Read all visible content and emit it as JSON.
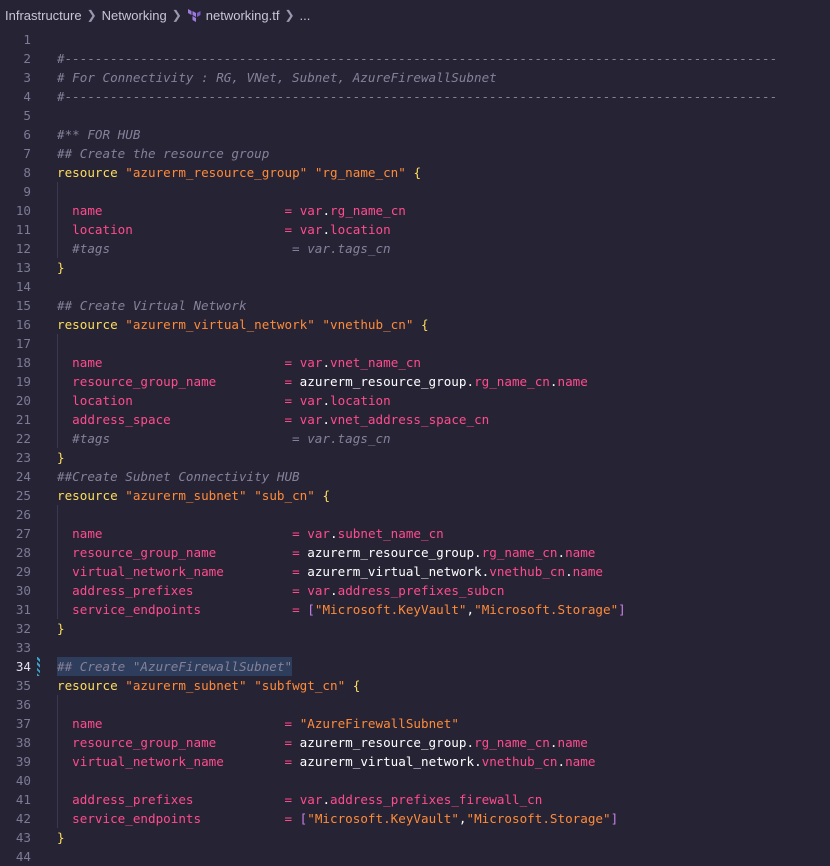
{
  "breadcrumb": {
    "items": [
      "Infrastructure",
      "Networking",
      "networking.tf",
      "..."
    ],
    "icon": "terraform-icon"
  },
  "editor": {
    "active_line": 34,
    "lines": [
      {
        "n": "1",
        "t": []
      },
      {
        "n": "2",
        "t": [
          [
            "c",
            "#----------------------------------------------------------------------------------------------"
          ]
        ]
      },
      {
        "n": "3",
        "t": [
          [
            "c",
            "# For Connectivity : RG, VNet, Subnet, AzureFirewallSubnet"
          ]
        ]
      },
      {
        "n": "4",
        "t": [
          [
            "c",
            "#----------------------------------------------------------------------------------------------"
          ]
        ]
      },
      {
        "n": "5",
        "t": []
      },
      {
        "n": "6",
        "t": [
          [
            "c",
            "#** FOR HUB"
          ]
        ]
      },
      {
        "n": "7",
        "t": [
          [
            "c",
            "## Create the resource group"
          ]
        ]
      },
      {
        "n": "8",
        "t": [
          [
            "kw",
            "resource"
          ],
          [
            "w",
            " "
          ],
          [
            "str",
            "\"azurerm_resource_group\""
          ],
          [
            "w",
            " "
          ],
          [
            "str",
            "\"rg_name_cn\""
          ],
          [
            "w",
            " "
          ],
          [
            "p",
            "{"
          ]
        ]
      },
      {
        "n": "9",
        "t": []
      },
      {
        "n": "10",
        "t": [
          [
            "w",
            "  "
          ],
          [
            "attr",
            "name"
          ],
          [
            "w",
            "                        "
          ],
          [
            "attr",
            "="
          ],
          [
            "w",
            " "
          ],
          [
            "attr",
            "var"
          ],
          [
            "w",
            "."
          ],
          [
            "attr",
            "rg_name_cn"
          ]
        ]
      },
      {
        "n": "11",
        "t": [
          [
            "w",
            "  "
          ],
          [
            "attr",
            "location"
          ],
          [
            "w",
            "                    "
          ],
          [
            "attr",
            "="
          ],
          [
            "w",
            " "
          ],
          [
            "attr",
            "var"
          ],
          [
            "w",
            "."
          ],
          [
            "attr",
            "location"
          ]
        ]
      },
      {
        "n": "12",
        "t": [
          [
            "w",
            "  "
          ],
          [
            "c",
            "#tags                        = var.tags_cn"
          ]
        ]
      },
      {
        "n": "13",
        "t": [
          [
            "p",
            "}"
          ]
        ]
      },
      {
        "n": "14",
        "t": []
      },
      {
        "n": "15",
        "t": [
          [
            "c",
            "## Create Virtual Network"
          ]
        ]
      },
      {
        "n": "16",
        "t": [
          [
            "kw",
            "resource"
          ],
          [
            "w",
            " "
          ],
          [
            "str",
            "\"azurerm_virtual_network\""
          ],
          [
            "w",
            " "
          ],
          [
            "str",
            "\"vnethub_cn\""
          ],
          [
            "w",
            " "
          ],
          [
            "p",
            "{"
          ]
        ]
      },
      {
        "n": "17",
        "t": []
      },
      {
        "n": "18",
        "t": [
          [
            "w",
            "  "
          ],
          [
            "attr",
            "name"
          ],
          [
            "w",
            "                        "
          ],
          [
            "attr",
            "="
          ],
          [
            "w",
            " "
          ],
          [
            "attr",
            "var"
          ],
          [
            "w",
            "."
          ],
          [
            "attr",
            "vnet_name_cn"
          ]
        ]
      },
      {
        "n": "19",
        "t": [
          [
            "w",
            "  "
          ],
          [
            "attr",
            "resource_group_name"
          ],
          [
            "w",
            "         "
          ],
          [
            "attr",
            "="
          ],
          [
            "w",
            " azurerm_resource_group."
          ],
          [
            "attr",
            "rg_name_cn"
          ],
          [
            "w",
            "."
          ],
          [
            "attr",
            "name"
          ]
        ]
      },
      {
        "n": "20",
        "t": [
          [
            "w",
            "  "
          ],
          [
            "attr",
            "location"
          ],
          [
            "w",
            "                    "
          ],
          [
            "attr",
            "="
          ],
          [
            "w",
            " "
          ],
          [
            "attr",
            "var"
          ],
          [
            "w",
            "."
          ],
          [
            "attr",
            "location"
          ]
        ]
      },
      {
        "n": "21",
        "t": [
          [
            "w",
            "  "
          ],
          [
            "attr",
            "address_space"
          ],
          [
            "w",
            "               "
          ],
          [
            "attr",
            "="
          ],
          [
            "w",
            " "
          ],
          [
            "attr",
            "var"
          ],
          [
            "w",
            "."
          ],
          [
            "attr",
            "vnet_address_space_cn"
          ]
        ]
      },
      {
        "n": "22",
        "t": [
          [
            "w",
            "  "
          ],
          [
            "c",
            "#tags                        = var.tags_cn"
          ]
        ]
      },
      {
        "n": "23",
        "t": [
          [
            "p",
            "}"
          ]
        ]
      },
      {
        "n": "24",
        "t": [
          [
            "c",
            "##Create Subnet Connectivity HUB"
          ]
        ]
      },
      {
        "n": "25",
        "t": [
          [
            "kw",
            "resource"
          ],
          [
            "w",
            " "
          ],
          [
            "str",
            "\"azurerm_subnet\""
          ],
          [
            "w",
            " "
          ],
          [
            "str",
            "\"sub_cn\""
          ],
          [
            "w",
            " "
          ],
          [
            "p",
            "{"
          ]
        ]
      },
      {
        "n": "26",
        "t": []
      },
      {
        "n": "27",
        "t": [
          [
            "w",
            "  "
          ],
          [
            "attr",
            "name"
          ],
          [
            "w",
            "                         "
          ],
          [
            "attr",
            "="
          ],
          [
            "w",
            " "
          ],
          [
            "attr",
            "var"
          ],
          [
            "w",
            "."
          ],
          [
            "attr",
            "subnet_name_cn"
          ]
        ]
      },
      {
        "n": "28",
        "t": [
          [
            "w",
            "  "
          ],
          [
            "attr",
            "resource_group_name"
          ],
          [
            "w",
            "          "
          ],
          [
            "attr",
            "="
          ],
          [
            "w",
            " azurerm_resource_group."
          ],
          [
            "attr",
            "rg_name_cn"
          ],
          [
            "w",
            "."
          ],
          [
            "attr",
            "name"
          ]
        ]
      },
      {
        "n": "29",
        "t": [
          [
            "w",
            "  "
          ],
          [
            "attr",
            "virtual_network_name"
          ],
          [
            "w",
            "         "
          ],
          [
            "attr",
            "="
          ],
          [
            "w",
            " azurerm_virtual_network."
          ],
          [
            "attr",
            "vnethub_cn"
          ],
          [
            "w",
            "."
          ],
          [
            "attr",
            "name"
          ]
        ]
      },
      {
        "n": "30",
        "t": [
          [
            "w",
            "  "
          ],
          [
            "attr",
            "address_prefixes"
          ],
          [
            "w",
            "             "
          ],
          [
            "attr",
            "="
          ],
          [
            "w",
            " "
          ],
          [
            "attr",
            "var"
          ],
          [
            "w",
            "."
          ],
          [
            "attr",
            "address_prefixes_subcn"
          ]
        ]
      },
      {
        "n": "31",
        "t": [
          [
            "w",
            "  "
          ],
          [
            "attr",
            "service_endpoints"
          ],
          [
            "w",
            "            "
          ],
          [
            "attr",
            "="
          ],
          [
            "w",
            " "
          ],
          [
            "br",
            "["
          ],
          [
            "str",
            "\"Microsoft.KeyVault\""
          ],
          [
            "w",
            ","
          ],
          [
            "str",
            "\"Microsoft.Storage\""
          ],
          [
            "br",
            "]"
          ]
        ]
      },
      {
        "n": "32",
        "t": [
          [
            "p",
            "}"
          ]
        ]
      },
      {
        "n": "33",
        "t": []
      },
      {
        "n": "34",
        "t": [
          [
            "c",
            "## Create \"AzureFirewallSubnet\""
          ]
        ],
        "highlight": true
      },
      {
        "n": "35",
        "t": [
          [
            "kw",
            "resource"
          ],
          [
            "w",
            " "
          ],
          [
            "str",
            "\"azurerm_subnet\""
          ],
          [
            "w",
            " "
          ],
          [
            "str",
            "\"subfwgt_cn\""
          ],
          [
            "w",
            " "
          ],
          [
            "p",
            "{"
          ]
        ]
      },
      {
        "n": "36",
        "t": []
      },
      {
        "n": "37",
        "t": [
          [
            "w",
            "  "
          ],
          [
            "attr",
            "name"
          ],
          [
            "w",
            "                        "
          ],
          [
            "attr",
            "="
          ],
          [
            "w",
            " "
          ],
          [
            "str",
            "\"AzureFirewallSubnet\""
          ]
        ]
      },
      {
        "n": "38",
        "t": [
          [
            "w",
            "  "
          ],
          [
            "attr",
            "resource_group_name"
          ],
          [
            "w",
            "         "
          ],
          [
            "attr",
            "="
          ],
          [
            "w",
            " azurerm_resource_group."
          ],
          [
            "attr",
            "rg_name_cn"
          ],
          [
            "w",
            "."
          ],
          [
            "attr",
            "name"
          ]
        ]
      },
      {
        "n": "39",
        "t": [
          [
            "w",
            "  "
          ],
          [
            "attr",
            "virtual_network_name"
          ],
          [
            "w",
            "        "
          ],
          [
            "attr",
            "="
          ],
          [
            "w",
            " azurerm_virtual_network."
          ],
          [
            "attr",
            "vnethub_cn"
          ],
          [
            "w",
            "."
          ],
          [
            "attr",
            "name"
          ]
        ]
      },
      {
        "n": "40",
        "t": []
      },
      {
        "n": "41",
        "t": [
          [
            "w",
            "  "
          ],
          [
            "attr",
            "address_prefixes"
          ],
          [
            "w",
            "            "
          ],
          [
            "attr",
            "="
          ],
          [
            "w",
            " "
          ],
          [
            "attr",
            "var"
          ],
          [
            "w",
            "."
          ],
          [
            "attr",
            "address_prefixes_firewall_cn"
          ]
        ]
      },
      {
        "n": "42",
        "t": [
          [
            "w",
            "  "
          ],
          [
            "attr",
            "service_endpoints"
          ],
          [
            "w",
            "           "
          ],
          [
            "attr",
            "="
          ],
          [
            "w",
            " "
          ],
          [
            "br",
            "["
          ],
          [
            "str",
            "\"Microsoft.KeyVault\""
          ],
          [
            "w",
            ","
          ],
          [
            "str",
            "\"Microsoft.Storage\""
          ],
          [
            "br",
            "]"
          ]
        ]
      },
      {
        "n": "43",
        "t": [
          [
            "p",
            "}"
          ]
        ]
      },
      {
        "n": "44",
        "t": []
      }
    ]
  }
}
